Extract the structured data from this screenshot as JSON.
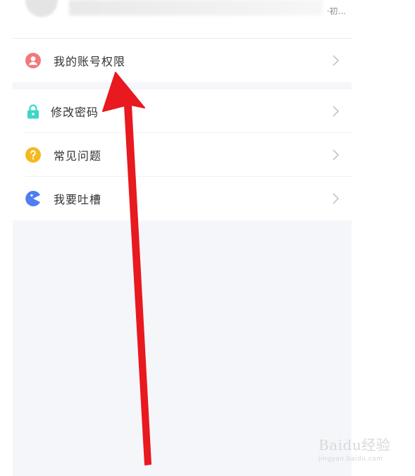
{
  "profile": {
    "hint": "·初..."
  },
  "menu": [
    {
      "label": "我的账号权限",
      "icon": "user-icon",
      "color": "#f2787a"
    },
    {
      "label": "修改密码",
      "icon": "lock-icon",
      "color": "#3dd6c8"
    },
    {
      "label": "常见问题",
      "icon": "question-icon",
      "color": "#f5b820"
    },
    {
      "label": "我要吐槽",
      "icon": "pacman-icon",
      "color": "#4f7ef0"
    }
  ],
  "watermark": {
    "brand": "Baidu经验",
    "url": "jingyan.baidu.com"
  },
  "colors": {
    "arrow": "#e8191f",
    "background": "#f5f6fa"
  }
}
